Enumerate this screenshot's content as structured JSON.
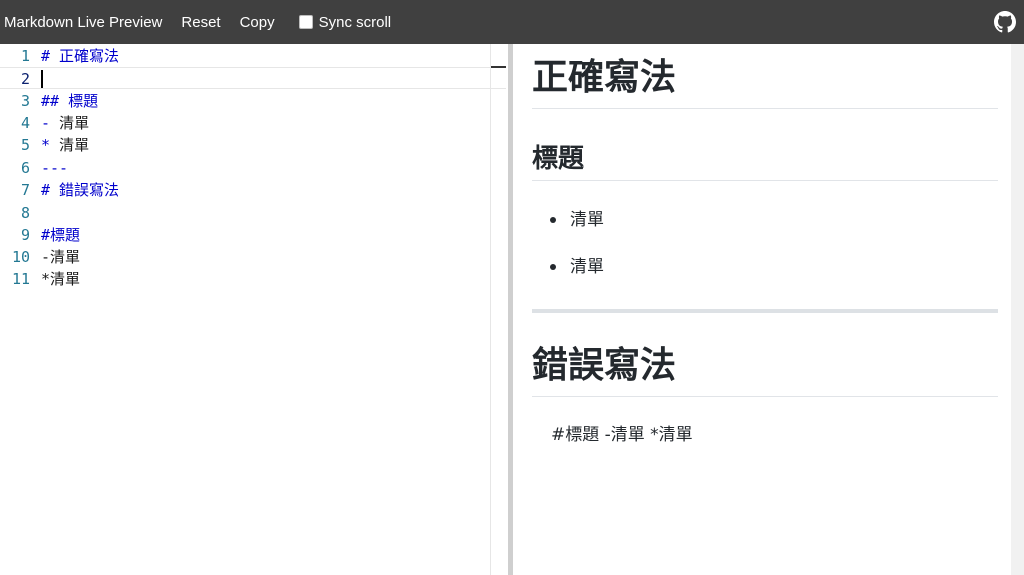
{
  "toolbar": {
    "title": "Markdown Live Preview",
    "reset_label": "Reset",
    "copy_label": "Copy",
    "sync_label": "Sync scroll",
    "sync_checked": false,
    "github_icon": "github-icon"
  },
  "editor": {
    "active_line": 2,
    "lines": [
      {
        "num": "1",
        "text": "# 正確寫法"
      },
      {
        "num": "2",
        "text": ""
      },
      {
        "num": "3",
        "text": "## 標題"
      },
      {
        "num": "4",
        "text": "- 清單"
      },
      {
        "num": "5",
        "text": "* 清單"
      },
      {
        "num": "6",
        "text": "---"
      },
      {
        "num": "7",
        "text": "# 錯誤寫法"
      },
      {
        "num": "8",
        "text": ""
      },
      {
        "num": "9",
        "text": "#標題"
      },
      {
        "num": "10",
        "text": "-清單"
      },
      {
        "num": "11",
        "text": "*清單"
      }
    ]
  },
  "preview": {
    "h1_correct": "正確寫法",
    "h2_title": "標題",
    "list_items": [
      "清單",
      "清單"
    ],
    "h1_wrong": "錯誤寫法",
    "paragraph": "#標題 -清單 *清單"
  },
  "colors": {
    "topbar_bg": "#404040",
    "markdown_syntax": "#0000cc",
    "line_number": "#237893"
  }
}
